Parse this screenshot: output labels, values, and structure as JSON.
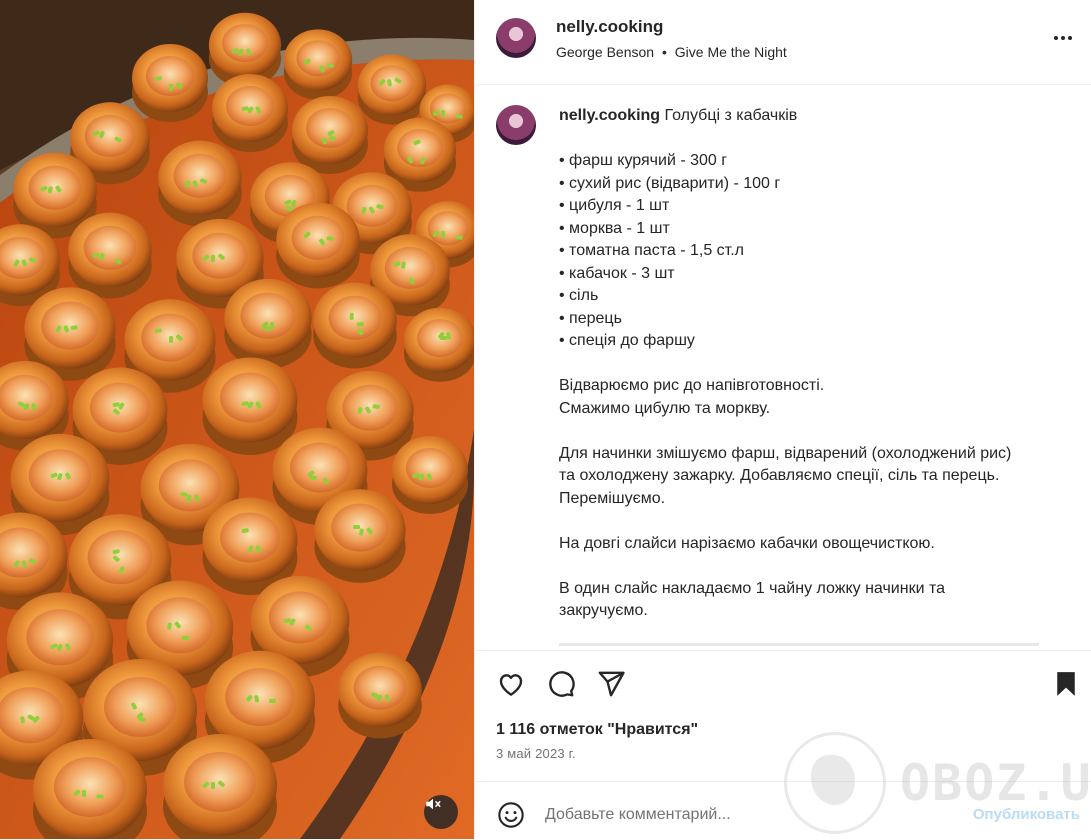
{
  "post": {
    "username": "nelly.cooking",
    "audio_artist": "George Benson",
    "audio_separator": "•",
    "audio_track": "Give Me the Night"
  },
  "caption": {
    "username": "nelly.cooking",
    "title": "Голубці з кабачків",
    "ingredients": [
      "• фарш курячий - 300 г",
      "• сухий рис (відварити) - 100 г",
      "• цибуля - 1 шт",
      "• морква - 1 шт",
      "• томатна паста - 1,5 ст.л",
      "• кабачок - 3 шт",
      "• сіль",
      "• перець",
      "• спеція до фаршу"
    ],
    "step1_line1": "Відварюємо рис до напівготовності.",
    "step1_line2": "Смажимо цибулю та моркву.",
    "step2_line1": "Для начинки змішуємо фарш, відварений (охолоджений рис)",
    "step2_line2": "та охолоджену зажарку. Добавляємо спеції, сіль та перець.",
    "step2_line3": "Перемішуємо.",
    "step3": "На довгі слайси нарізаємо кабачки овощечисткою.",
    "step4_line1": "В один слайс накладаємо 1 чайну ложку начинки та",
    "step4_line2": "закручуємо."
  },
  "engagement": {
    "likes": "1 116 отметок \"Нравится\"",
    "date": "3 май 2023 г."
  },
  "comment": {
    "placeholder": "Добавьте комментарий...",
    "post_label": "Опубликовать"
  },
  "watermark": {
    "text": "OBOZ.UA"
  },
  "icons": {
    "more": "more-horizontal-icon",
    "like": "heart-icon",
    "comment": "comment-bubble-icon",
    "share": "paper-plane-icon",
    "save": "bookmark-icon",
    "emoji": "emoji-smile-icon",
    "mute": "speaker-muted-icon"
  },
  "colors": {
    "sauce": "#d9561f",
    "roll": "#e89a3a",
    "scallion": "#8fcf3a",
    "post_button": "#b9dcf7"
  }
}
